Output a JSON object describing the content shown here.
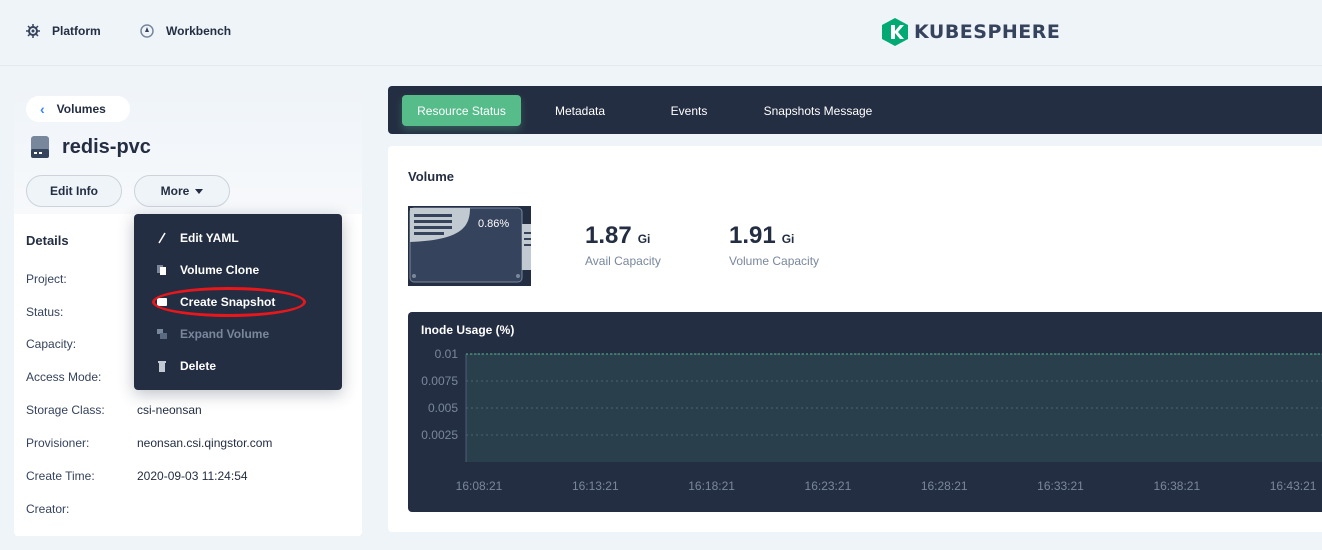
{
  "topbar": {
    "platform_label": "Platform",
    "workbench_label": "Workbench",
    "logo_text": "KUBESPHERE"
  },
  "left": {
    "back_label": "Volumes",
    "title": "redis-pvc",
    "edit_info_label": "Edit Info",
    "more_label": "More",
    "details_heading": "Details",
    "details": [
      {
        "label": "Project:",
        "value": ""
      },
      {
        "label": "Status:",
        "value": ""
      },
      {
        "label": "Capacity:",
        "value": ""
      },
      {
        "label": "Access Mode:",
        "value": ""
      },
      {
        "label": "Storage Class:",
        "value": "csi-neonsan"
      },
      {
        "label": "Provisioner:",
        "value": "neonsan.csi.qingstor.com"
      },
      {
        "label": "Create Time:",
        "value": "2020-09-03 11:24:54"
      },
      {
        "label": "Creator:",
        "value": ""
      }
    ]
  },
  "menu": {
    "items": [
      {
        "label": "Edit YAML",
        "icon": "pen-icon",
        "disabled": false
      },
      {
        "label": "Volume Clone",
        "icon": "copy-icon",
        "disabled": false
      },
      {
        "label": "Create Snapshot",
        "icon": "snapshot-icon",
        "disabled": false
      },
      {
        "label": "Expand Volume",
        "icon": "expand-icon",
        "disabled": true
      },
      {
        "label": "Delete",
        "icon": "trash-icon",
        "disabled": false
      }
    ]
  },
  "tabs": [
    "Resource Status",
    "Metadata",
    "Events",
    "Snapshots Message"
  ],
  "volume": {
    "heading": "Volume",
    "usage_percent": "0.86%",
    "avail_value": "1.87",
    "avail_unit": "Gi",
    "avail_label": "Avail Capacity",
    "capacity_value": "1.91",
    "capacity_unit": "Gi",
    "capacity_label": "Volume Capacity"
  },
  "chart_data": {
    "type": "area",
    "title": "Inode Usage (%)",
    "x": [
      "16:08:21",
      "16:13:21",
      "16:18:21",
      "16:23:21",
      "16:28:21",
      "16:33:21",
      "16:38:21",
      "16:43:21"
    ],
    "series": [
      {
        "values": [
          0.01,
          0.01,
          0.01,
          0.01,
          0.01,
          0.01,
          0.01,
          0.01
        ]
      }
    ],
    "yticks": [
      "0.01",
      "0.0075",
      "0.005",
      "0.0025"
    ],
    "ylim": [
      0,
      0.01
    ],
    "grid": true
  },
  "colors": {
    "accent": "#55bc8a",
    "dark": "#242e42",
    "highlight": "#e8171c"
  }
}
